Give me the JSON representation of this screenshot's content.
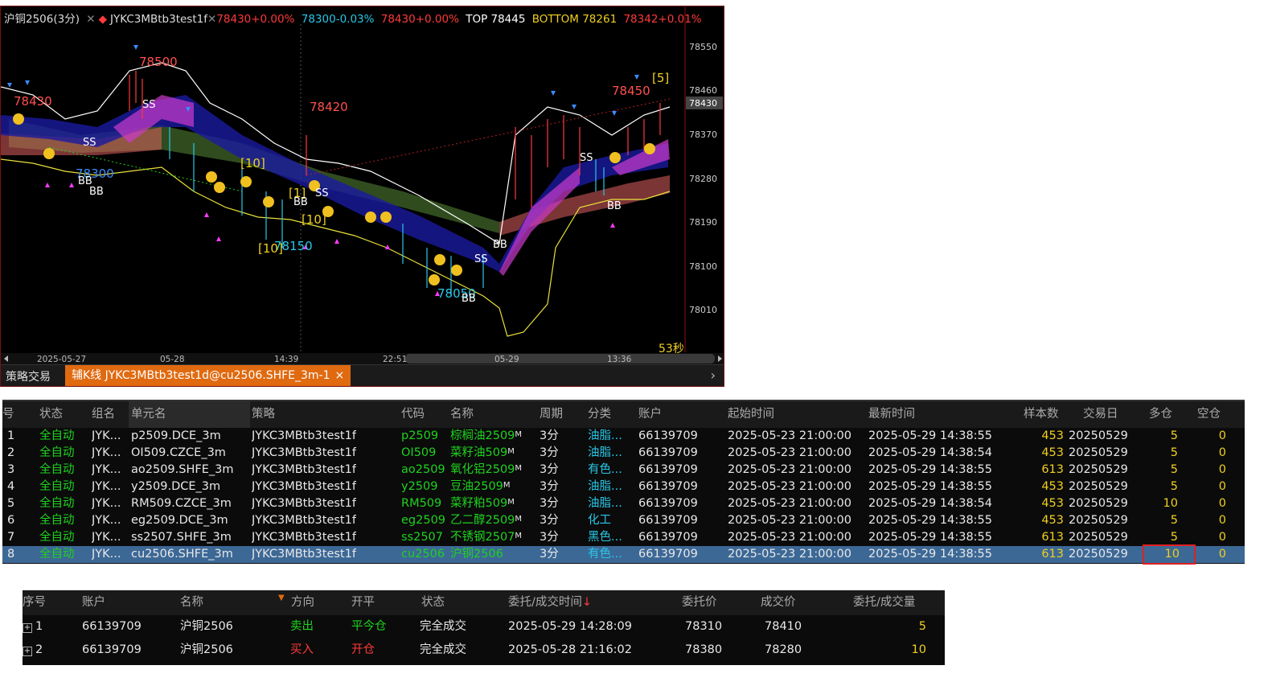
{
  "chart": {
    "symbol": "沪铜2506(3分)",
    "indicator_label": "JYKC3MBtb3test1f",
    "val1": "78430+0.00%",
    "val2": "78300-0.03%",
    "val3": "78430+0.00%",
    "top": "TOP 78445",
    "bottom": "BOTTOM 78261",
    "val4": "78342+0.01%",
    "price_ticks": [
      "78550",
      "78460",
      "78430",
      "78370",
      "78280",
      "78190",
      "78100",
      "78010"
    ],
    "time_ticks": [
      "2025-05-27",
      "05-28",
      "14:39",
      "22:51",
      "05-29",
      "13:36"
    ],
    "annotations": {
      "a78500": "78500",
      "a78430": "78430",
      "a78420": "78420",
      "a78450": "78450",
      "a78300": "78300",
      "a78150": "78150",
      "a78050": "78050",
      "bracket5": "[5]",
      "bracket10a": "[10]",
      "bracket10b": "[10]",
      "bracket10c": "[10]",
      "bracket1": "[1]"
    },
    "markers": {
      "ss": "SS",
      "bb": "BB"
    },
    "countdown": "53秒"
  },
  "tabs": {
    "static_label": "策略交易",
    "active_label": "辅K线 JYKC3MBtb3test1d@cu2506.SHFE_3m-1",
    "close": "×",
    "arrow": "›"
  },
  "strategy_table": {
    "headers": [
      "号",
      "状态",
      "组名",
      "单元名",
      "策略",
      "代码",
      "名称",
      "周期",
      "分类",
      "账户",
      "起始时间",
      "最新时间",
      "样本数",
      "交易日",
      "多仓",
      "空仓"
    ],
    "rows": [
      {
        "no": "1",
        "status": "全自动",
        "group": "JYK...",
        "unit": "p2509.DCE_3m",
        "strategy": "JYKC3MBtb3test1f",
        "code": "p2509",
        "name": "棕榈油2509",
        "sup": "M",
        "period": "3分",
        "category": "油脂...",
        "account": "66139709",
        "start": "2025-05-23 21:00:00",
        "latest": "2025-05-29 14:38:55",
        "samples": "453",
        "tradedate": "20250529",
        "long": "5",
        "short": "0"
      },
      {
        "no": "2",
        "status": "全自动",
        "group": "JYK...",
        "unit": "OI509.CZCE_3m",
        "strategy": "JYKC3MBtb3test1f",
        "code": "OI509",
        "name": "菜籽油509",
        "sup": "M",
        "period": "3分",
        "category": "油脂...",
        "account": "66139709",
        "start": "2025-05-23 21:00:00",
        "latest": "2025-05-29 14:38:54",
        "samples": "453",
        "tradedate": "20250529",
        "long": "5",
        "short": "0"
      },
      {
        "no": "3",
        "status": "全自动",
        "group": "JYK...",
        "unit": "ao2509.SHFE_3m",
        "strategy": "JYKC3MBtb3test1f",
        "code": "ao2509",
        "name": "氧化铝2509",
        "sup": "M",
        "period": "3分",
        "category": "有色...",
        "account": "66139709",
        "start": "2025-05-23 21:00:00",
        "latest": "2025-05-29 14:38:55",
        "samples": "613",
        "tradedate": "20250529",
        "long": "5",
        "short": "0"
      },
      {
        "no": "4",
        "status": "全自动",
        "group": "JYK...",
        "unit": "y2509.DCE_3m",
        "strategy": "JYKC3MBtb3test1f",
        "code": "y2509",
        "name": "豆油2509",
        "sup": "M",
        "period": "3分",
        "category": "油脂...",
        "account": "66139709",
        "start": "2025-05-23 21:00:00",
        "latest": "2025-05-29 14:38:55",
        "samples": "453",
        "tradedate": "20250529",
        "long": "5",
        "short": "0"
      },
      {
        "no": "5",
        "status": "全自动",
        "group": "JYK...",
        "unit": "RM509.CZCE_3m",
        "strategy": "JYKC3MBtb3test1f",
        "code": "RM509",
        "name": "菜籽粕509",
        "sup": "M",
        "period": "3分",
        "category": "油脂...",
        "account": "66139709",
        "start": "2025-05-23 21:00:00",
        "latest": "2025-05-29 14:38:54",
        "samples": "453",
        "tradedate": "20250529",
        "long": "10",
        "short": "0"
      },
      {
        "no": "6",
        "status": "全自动",
        "group": "JYK...",
        "unit": "eg2509.DCE_3m",
        "strategy": "JYKC3MBtb3test1f",
        "code": "eg2509",
        "name": "乙二醇2509",
        "sup": "M",
        "period": "3分",
        "category": "化工",
        "account": "66139709",
        "start": "2025-05-23 21:00:00",
        "latest": "2025-05-29 14:38:55",
        "samples": "453",
        "tradedate": "20250529",
        "long": "5",
        "short": "0"
      },
      {
        "no": "7",
        "status": "全自动",
        "group": "JYK...",
        "unit": "ss2507.SHFE_3m",
        "strategy": "JYKC3MBtb3test1f",
        "code": "ss2507",
        "name": "不锈钢2507",
        "sup": "M",
        "period": "3分",
        "category": "黑色...",
        "account": "66139709",
        "start": "2025-05-23 21:00:00",
        "latest": "2025-05-29 14:38:55",
        "samples": "613",
        "tradedate": "20250529",
        "long": "5",
        "short": "0"
      },
      {
        "no": "8",
        "status": "全自动",
        "group": "JYK...",
        "unit": "cu2506.SHFE_3m",
        "strategy": "JYKC3MBtb3test1f",
        "code": "cu2506",
        "name": "沪铜2506",
        "sup": "",
        "period": "3分",
        "category": "有色...",
        "account": "66139709",
        "start": "2025-05-23 21:00:00",
        "latest": "2025-05-29 14:38:55",
        "samples": "613",
        "tradedate": "20250529",
        "long": "10",
        "short": "0"
      }
    ]
  },
  "order_table": {
    "headers": [
      "序号",
      "账户",
      "名称",
      "方向",
      "开平",
      "状态",
      "委托/成交时间",
      "委托价",
      "成交价",
      "委托/成交量"
    ],
    "sort_arrow": "↓",
    "rows": [
      {
        "no": "1",
        "account": "66139709",
        "name": "沪铜2506",
        "dir": "卖出",
        "oc": "平今仓",
        "status": "完全成交",
        "time": "2025-05-29 14:28:09",
        "order_price": "78310",
        "fill_price": "78410",
        "qty": "5"
      },
      {
        "no": "2",
        "account": "66139709",
        "name": "沪铜2506",
        "dir": "买入",
        "oc": "开仓",
        "status": "完全成交",
        "time": "2025-05-28 21:16:02",
        "order_price": "78380",
        "fill_price": "78280",
        "qty": "10"
      }
    ]
  },
  "colors": {
    "up": "#ff3a3a",
    "down": "#28c8e8",
    "green": "#1fd21f",
    "yellow": "#f0d020",
    "accent": "#e06a10",
    "selected": "#3c6896"
  }
}
